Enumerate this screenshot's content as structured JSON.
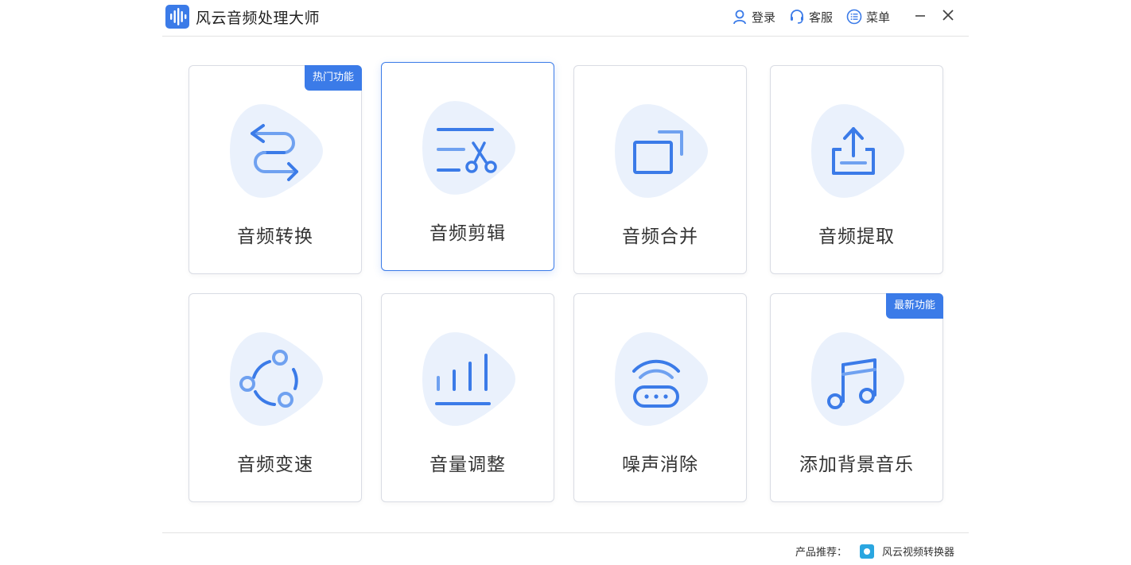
{
  "app": {
    "title": "风云音频处理大师"
  },
  "header": {
    "login": "登录",
    "support": "客服",
    "menu": "菜单"
  },
  "colors": {
    "accent": "#3b7be8",
    "icon_light": "#6fa1f0",
    "blob": "#eaf1fc"
  },
  "cards": [
    {
      "label": "音频转换",
      "icon": "convert-icon",
      "badge": "热门功能"
    },
    {
      "label": "音频剪辑",
      "icon": "scissors-icon",
      "badge": ""
    },
    {
      "label": "音频合并",
      "icon": "merge-icon",
      "badge": ""
    },
    {
      "label": "音频提取",
      "icon": "export-icon",
      "badge": ""
    },
    {
      "label": "音频变速",
      "icon": "speed-icon",
      "badge": ""
    },
    {
      "label": "音量调整",
      "icon": "volume-bars-icon",
      "badge": ""
    },
    {
      "label": "噪声消除",
      "icon": "noise-removal-icon",
      "badge": ""
    },
    {
      "label": "添加背景音乐",
      "icon": "music-note-icon",
      "badge": "最新功能"
    }
  ],
  "footer": {
    "recommend_label": "产品推荐：",
    "product_name": "风云视频转换器"
  }
}
